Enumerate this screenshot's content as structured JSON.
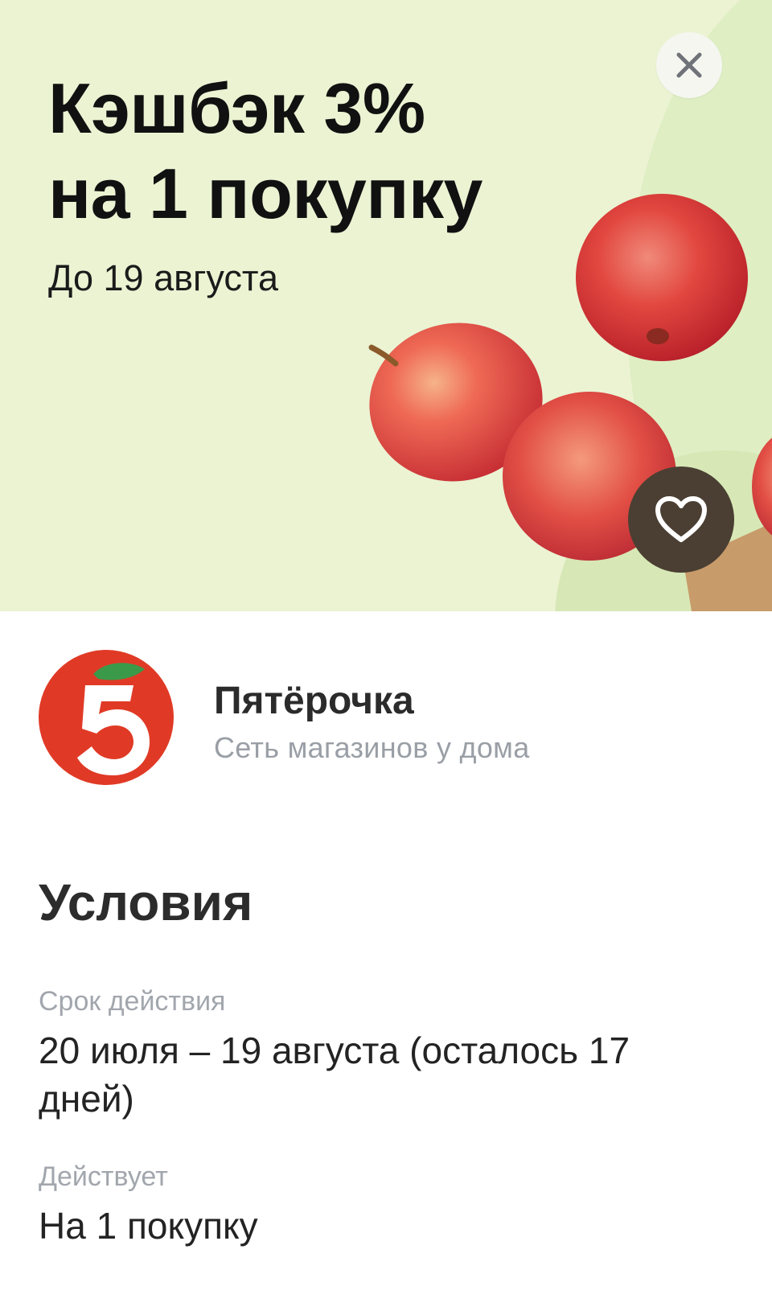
{
  "offer": {
    "title_line1": "Кэшбэк 3%",
    "title_line2": "на 1 покупку",
    "valid_until": "До 19 августа",
    "banner_bg": "#ebf3d3"
  },
  "actions": {
    "close_icon": "close-icon",
    "favorite_icon": "heart-icon"
  },
  "merchant": {
    "name": "Пятёрочка",
    "description": "Сеть магазинов у дома",
    "logo_digit": "5",
    "logo_color": "#e03a26",
    "leaf_color": "#3a9a4a"
  },
  "conditions": {
    "title": "Условия",
    "items": [
      {
        "label": "Срок действия",
        "value": "20 июля – 19 августа (осталось 17 дней)"
      },
      {
        "label": "Действует",
        "value": "На 1 покупку"
      }
    ]
  }
}
